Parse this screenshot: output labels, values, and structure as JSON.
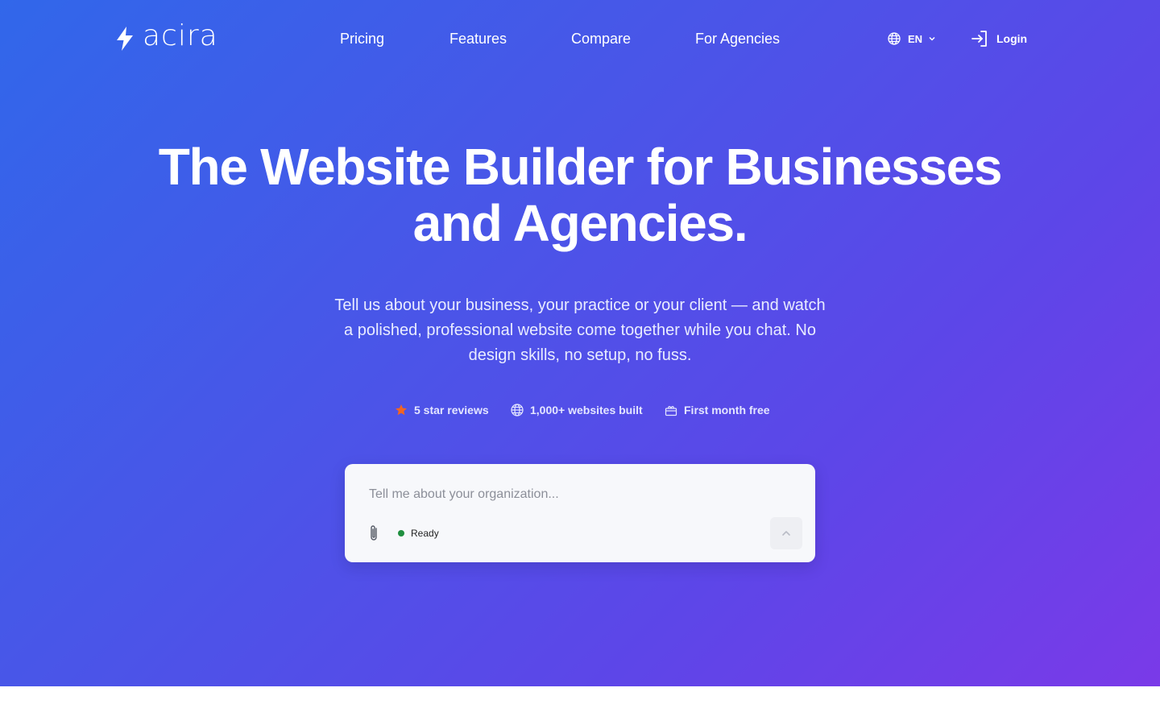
{
  "brand": {
    "name": "acira",
    "logo_icon": "lightning-bolt-icon"
  },
  "nav": {
    "items": [
      {
        "label": "Pricing"
      },
      {
        "label": "Features"
      },
      {
        "label": "Compare"
      },
      {
        "label": "For Agencies"
      }
    ]
  },
  "header": {
    "language": {
      "value": "EN",
      "icon": "globe-icon"
    },
    "login": {
      "label": "Login",
      "icon": "login-icon"
    }
  },
  "hero": {
    "title_line1": "The Website Builder for Businesses",
    "title_line2": "and Agencies.",
    "subtitle": "Tell us about your business, your practice or your client — and watch a polished, professional website come together while you chat. No design skills, no setup, no fuss.",
    "badges": [
      {
        "label": "5 star reviews",
        "icon": "star-icon"
      },
      {
        "label": "1,000+ websites built",
        "icon": "globe-icon"
      },
      {
        "label": "First month free",
        "icon": "gift-icon"
      }
    ]
  },
  "prompt": {
    "placeholder": "Tell me about your organization...",
    "value": "",
    "status": "Ready",
    "attach_icon": "paperclip-icon",
    "send_icon": "chevron-up-icon"
  },
  "colors": {
    "gradient_start": "#3167ea",
    "gradient_end": "#7a3ae8",
    "star": "#f26522",
    "status_ready": "#1f8f3f"
  }
}
